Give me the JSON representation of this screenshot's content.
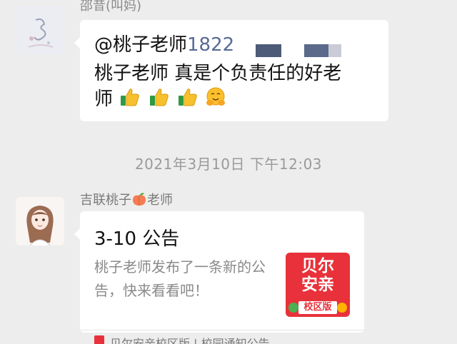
{
  "message1": {
    "sender": "邵昔(叫妈)",
    "mention_name": "@桃子老师",
    "mention_number": "1822",
    "line2": "桃子老师 真是个负责任的好老",
    "line3": "师",
    "emojis": [
      "thumbs-up-icon",
      "thumbs-up-icon",
      "thumbs-up-icon",
      "hugging-face-icon"
    ]
  },
  "timestamp": "2021年3月10日 下午12:03",
  "message2": {
    "sender_prefix": "吉联桃子",
    "sender_suffix": "老师",
    "sender_emoji": "peach-icon",
    "card": {
      "title": "3-10 公告",
      "description": "桃子老师发布了一条新的公告，快来看看吧！",
      "app_icon": {
        "name_line1": "贝尔",
        "name_line2": "安亲",
        "badge": "校区版"
      },
      "source": "贝尔安亲校区版 | 校园通知公告"
    }
  },
  "colors": {
    "background": "#ededed",
    "bubble": "#ffffff",
    "mention_number": "#576b95",
    "timestamp": "#9a9a9a",
    "app_icon": "#e8313a"
  }
}
